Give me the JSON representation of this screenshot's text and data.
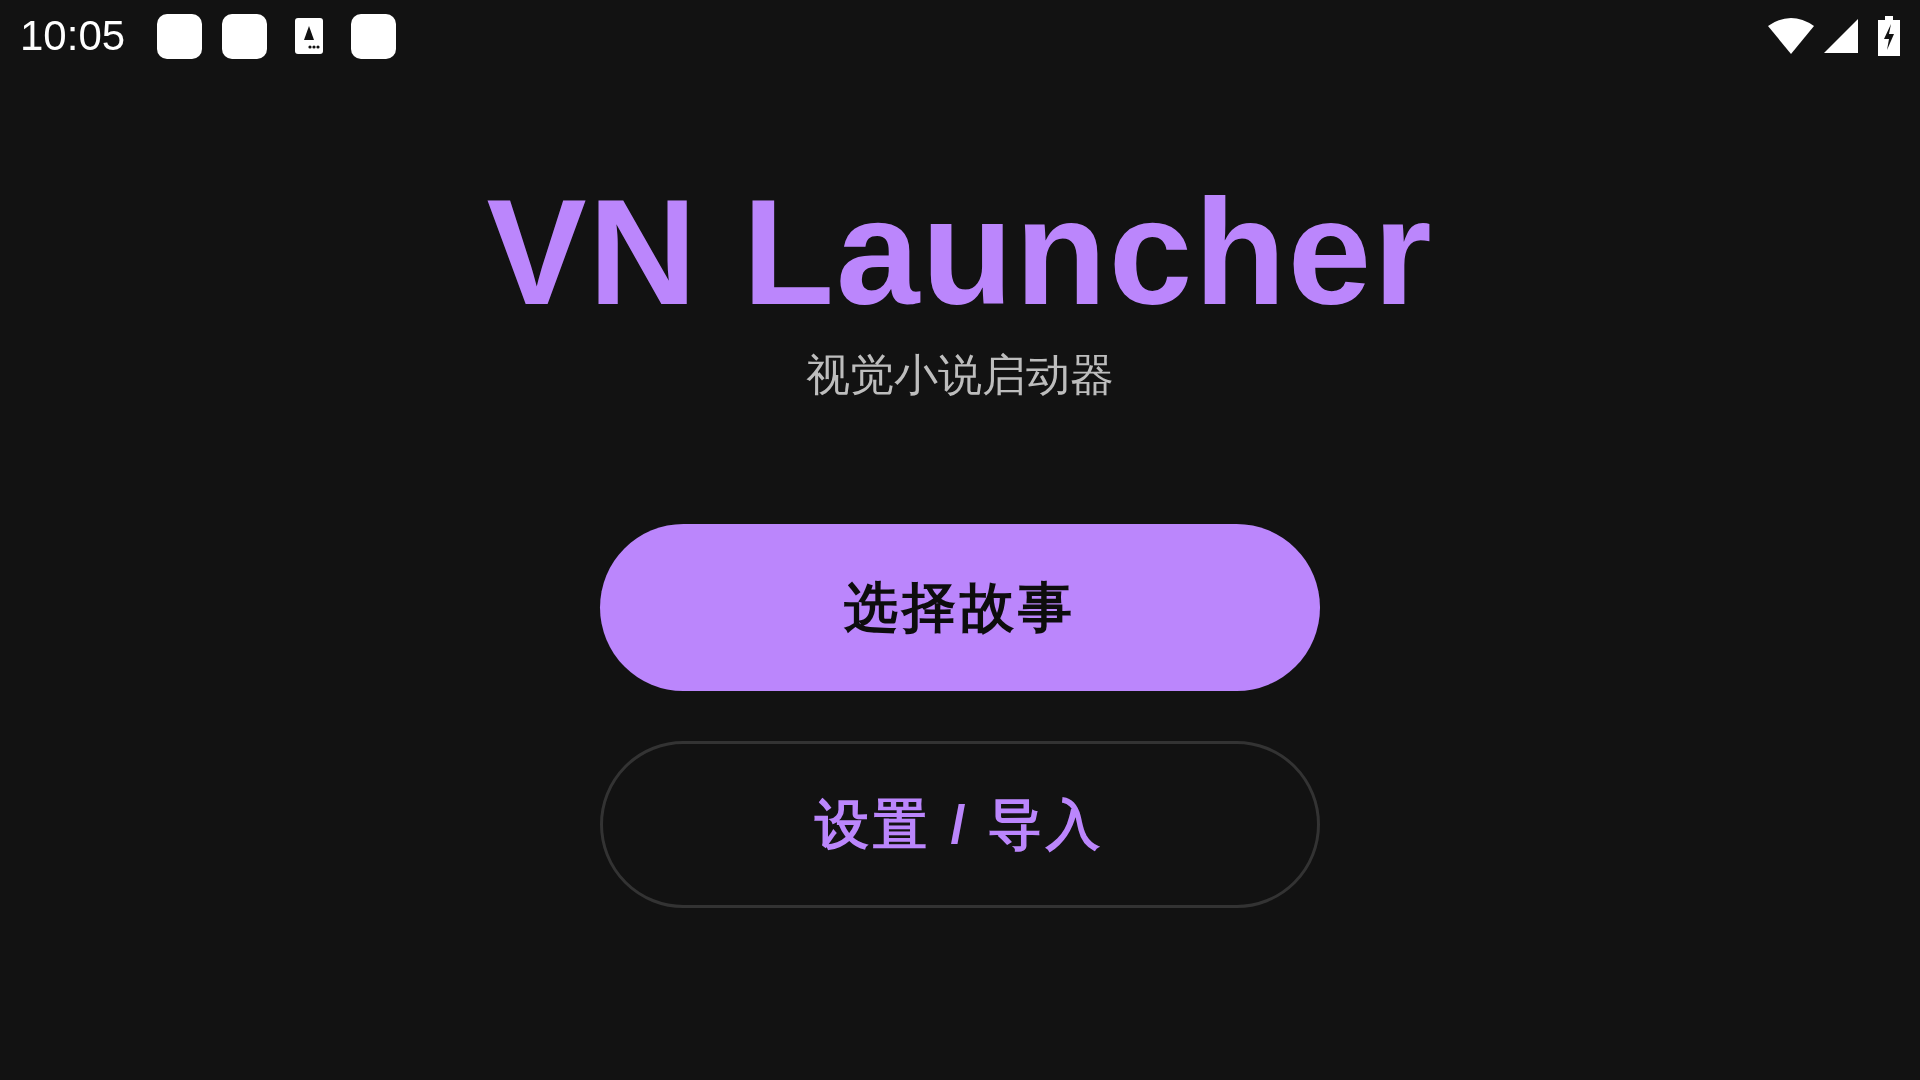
{
  "status_bar": {
    "time": "10:05"
  },
  "title": "VN Launcher",
  "subtitle": "视觉小说启动器",
  "buttons": [
    {
      "label": "选择故事",
      "kind": "filled"
    },
    {
      "label": "设置 / 导入",
      "kind": "outlined"
    }
  ]
}
